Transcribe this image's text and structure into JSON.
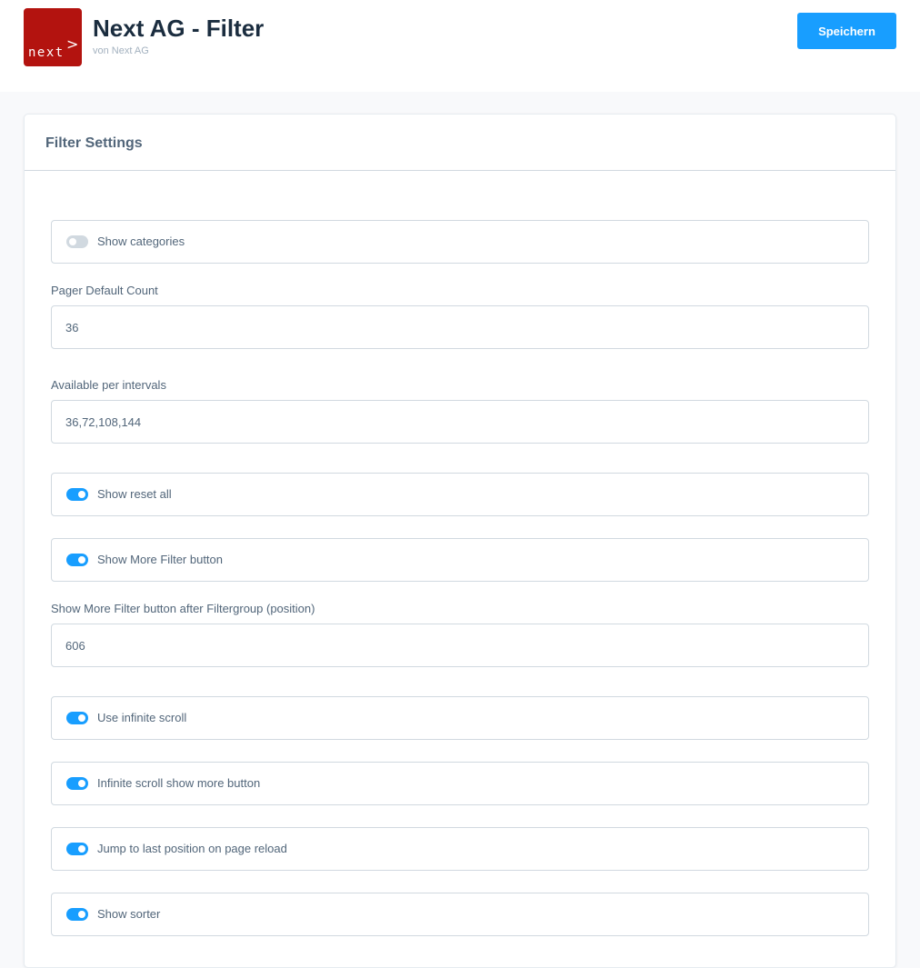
{
  "header": {
    "logo_text": "next",
    "logo_arrow": ">",
    "title": "Next AG - Filter",
    "subtitle": "von Next AG",
    "save_label": "Speichern"
  },
  "card": {
    "title": "Filter Settings"
  },
  "settings": {
    "show_categories": {
      "label": "Show categories",
      "enabled": false
    },
    "pager_default_count": {
      "label": "Pager Default Count",
      "value": "36"
    },
    "available_intervals": {
      "label": "Available per intervals",
      "value": "36,72,108,144"
    },
    "show_reset_all": {
      "label": "Show reset all",
      "enabled": true
    },
    "show_more_filter_button": {
      "label": "Show More Filter button",
      "enabled": true
    },
    "more_filter_position": {
      "label": "Show More Filter button after Filtergroup (position)",
      "value": "606"
    },
    "use_infinite_scroll": {
      "label": "Use infinite scroll",
      "enabled": true
    },
    "infinite_scroll_more_button": {
      "label": "Infinite scroll show more button",
      "enabled": true
    },
    "jump_last_position": {
      "label": "Jump to last position on page reload",
      "enabled": true
    },
    "show_sorter": {
      "label": "Show sorter",
      "enabled": true
    }
  },
  "colors": {
    "accent": "#189eff",
    "logo_red": "#b3130f",
    "toggle_off": "#d1d9e0"
  }
}
